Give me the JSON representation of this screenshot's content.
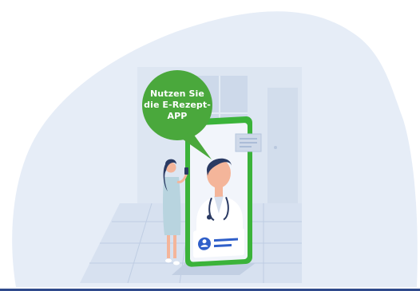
{
  "bubble": {
    "lines": [
      "Nutzen Sie",
      "die E-Rezept-",
      "APP"
    ]
  },
  "colors": {
    "blob_background": "#e6edf7",
    "room_wall": "#dfe8f4",
    "phone_green": "#3bb33a",
    "bubble_green": "#4aa83c",
    "doctor_screen": "#f2f5fb",
    "bottom_rule": "#2f4a8c",
    "card_blue": "#2f5fc9"
  },
  "icons": [
    "user-avatar-icon",
    "chat-window-icon"
  ]
}
